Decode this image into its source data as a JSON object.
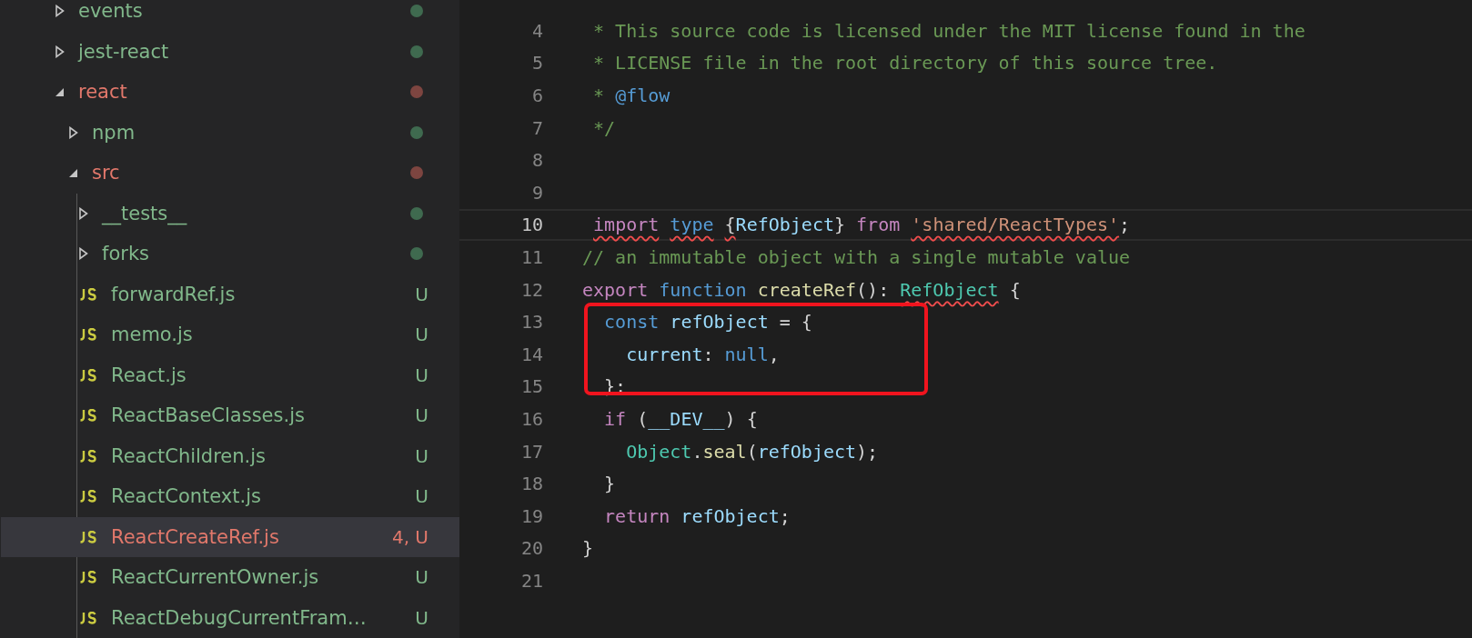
{
  "explorer": {
    "items": [
      {
        "kind": "folder",
        "label": "events",
        "expanded": false,
        "modified": false,
        "color": "#3f6a4f"
      },
      {
        "kind": "folder",
        "label": "jest-react",
        "expanded": false,
        "modified": false,
        "color": "#3f6a4f"
      },
      {
        "kind": "folder",
        "label": "react",
        "expanded": true,
        "modified": true,
        "color": "#7d4540",
        "children": [
          {
            "kind": "folder",
            "label": "npm",
            "expanded": false,
            "modified": false,
            "color": "#3f6a4f"
          },
          {
            "kind": "folder",
            "label": "src",
            "expanded": true,
            "modified": true,
            "color": "#7d4540",
            "children": [
              {
                "kind": "folder",
                "label": "__tests__",
                "expanded": false,
                "modified": false,
                "color": "#3f6a4f"
              },
              {
                "kind": "folder",
                "label": "forks",
                "expanded": false,
                "modified": false,
                "color": "#3f6a4f"
              },
              {
                "kind": "file",
                "label": "forwardRef.js",
                "modified": false,
                "badge": "U",
                "selected": false
              },
              {
                "kind": "file",
                "label": "memo.js",
                "modified": false,
                "badge": "U",
                "selected": false
              },
              {
                "kind": "file",
                "label": "React.js",
                "modified": false,
                "badge": "U",
                "selected": false
              },
              {
                "kind": "file",
                "label": "ReactBaseClasses.js",
                "modified": false,
                "badge": "U",
                "selected": false
              },
              {
                "kind": "file",
                "label": "ReactChildren.js",
                "modified": false,
                "badge": "U",
                "selected": false
              },
              {
                "kind": "file",
                "label": "ReactContext.js",
                "modified": false,
                "badge": "U",
                "selected": false
              },
              {
                "kind": "file",
                "label": "ReactCreateRef.js",
                "modified": true,
                "badge": "4, U",
                "selected": true
              },
              {
                "kind": "file",
                "label": "ReactCurrentOwner.js",
                "modified": false,
                "badge": "U",
                "selected": false
              },
              {
                "kind": "file",
                "label": "ReactDebugCurrentFram…",
                "modified": false,
                "badge": "U",
                "selected": false
              }
            ]
          }
        ]
      }
    ]
  },
  "editor": {
    "lines": [
      {
        "number": "4",
        "current": false,
        "boxed": false,
        "tokens": [
          {
            "kind": "comment",
            "text": " * This source code is licensed under the MIT license found in the"
          }
        ]
      },
      {
        "number": "5",
        "current": false,
        "boxed": false,
        "tokens": [
          {
            "kind": "comment",
            "text": " * LICENSE file in the root directory of this source tree."
          }
        ]
      },
      {
        "number": "6",
        "current": false,
        "boxed": false,
        "tokens": [
          {
            "kind": "comment",
            "text": " *"
          },
          {
            "kind": "storage",
            "text": " @flow"
          }
        ]
      },
      {
        "number": "7",
        "current": false,
        "boxed": false,
        "tokens": [
          {
            "kind": "comment",
            "text": " */"
          }
        ]
      },
      {
        "number": "8",
        "current": false,
        "boxed": false
      },
      {
        "number": "9",
        "current": false,
        "boxed": false
      },
      {
        "number": "10",
        "current": true,
        "boxed": false,
        "tokens": [
          {
            "kind": "keyword",
            "text": " import",
            "error": true
          },
          {
            "kind": "storage",
            "text": " type",
            "error": true
          },
          {
            "kind": "plain",
            "text": " {",
            "error": true
          },
          {
            "kind": "var",
            "text": "RefObject"
          },
          {
            "kind": "plain",
            "text": "}"
          },
          {
            "kind": "keyword",
            "text": " from"
          },
          {
            "kind": "string",
            "text": " 'shared/ReactTypes'",
            "error": true
          },
          {
            "kind": "plain",
            "text": ";"
          }
        ]
      },
      {
        "number": "11",
        "current": false,
        "boxed": false,
        "tokens": [
          {
            "kind": "comment",
            "text": "// an immutable object with a single mutable value"
          }
        ]
      },
      {
        "number": "12",
        "current": false,
        "boxed": false,
        "tokens": [
          {
            "kind": "keyword",
            "text": "export"
          },
          {
            "kind": "storage",
            "text": " function"
          },
          {
            "kind": "func",
            "text": " createRef"
          },
          {
            "kind": "plain",
            "text": "():"
          },
          {
            "kind": "type",
            "text": " RefObject",
            "error": true
          },
          {
            "kind": "plain",
            "text": " {"
          }
        ]
      },
      {
        "number": "13",
        "current": false,
        "boxed": true,
        "tokens": [
          {
            "kind": "storage",
            "text": "  const"
          },
          {
            "kind": "var",
            "text": " refObject"
          },
          {
            "kind": "plain",
            "text": " = {"
          }
        ]
      },
      {
        "number": "14",
        "current": false,
        "boxed": true,
        "tokens": [
          {
            "kind": "var",
            "text": "    current"
          },
          {
            "kind": "plain",
            "text": ":"
          },
          {
            "kind": "storage",
            "text": " null"
          },
          {
            "kind": "plain",
            "text": ","
          }
        ]
      },
      {
        "number": "15",
        "current": false,
        "boxed": true,
        "tokens": [
          {
            "kind": "plain",
            "text": "  };"
          }
        ]
      },
      {
        "number": "16",
        "current": false,
        "boxed": false,
        "tokens": [
          {
            "kind": "keyword",
            "text": "  if"
          },
          {
            "kind": "plain",
            "text": " ("
          },
          {
            "kind": "var",
            "text": "__DEV__"
          },
          {
            "kind": "plain",
            "text": ") {"
          }
        ]
      },
      {
        "number": "17",
        "current": false,
        "boxed": false,
        "tokens": [
          {
            "kind": "type",
            "text": "    Object"
          },
          {
            "kind": "plain",
            "text": "."
          },
          {
            "kind": "func",
            "text": "seal"
          },
          {
            "kind": "plain",
            "text": "("
          },
          {
            "kind": "var",
            "text": "refObject"
          },
          {
            "kind": "plain",
            "text": ");"
          }
        ]
      },
      {
        "number": "18",
        "current": false,
        "boxed": false,
        "tokens": [
          {
            "kind": "plain",
            "text": "  }"
          }
        ]
      },
      {
        "number": "19",
        "current": false,
        "boxed": false,
        "tokens": [
          {
            "kind": "keyword",
            "text": "  return"
          },
          {
            "kind": "var",
            "text": " refObject"
          },
          {
            "kind": "plain",
            "text": ";"
          }
        ]
      },
      {
        "number": "20",
        "current": false,
        "boxed": false,
        "tokens": [
          {
            "kind": "plain",
            "text": "}"
          }
        ]
      },
      {
        "number": "21",
        "current": false,
        "boxed": false
      }
    ]
  }
}
